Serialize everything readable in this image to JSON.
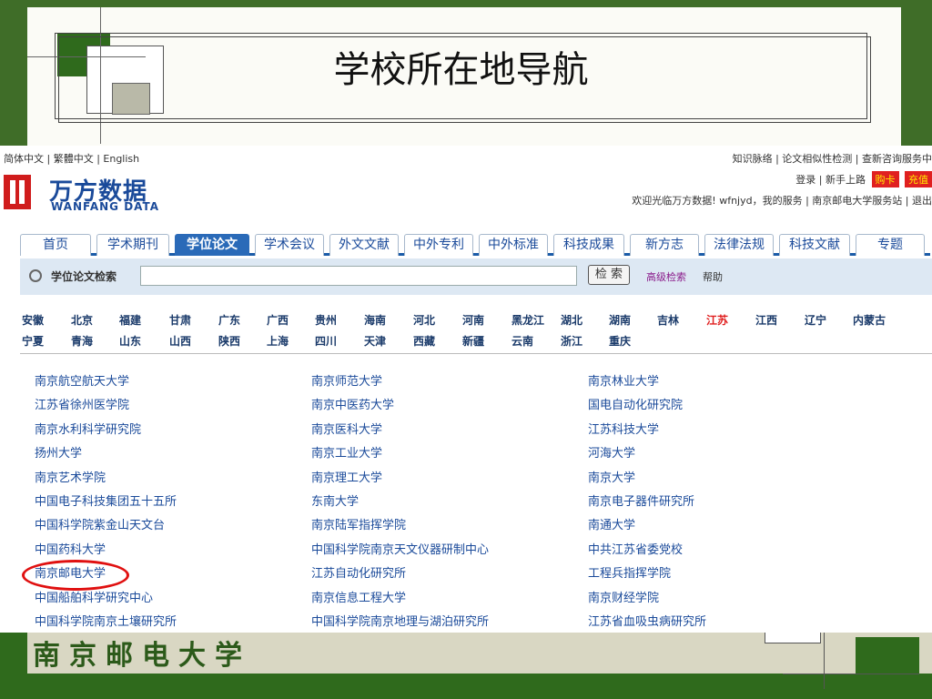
{
  "slide": {
    "title": "学校所在地导航",
    "footer_logo_text": "南京邮电大学"
  },
  "header": {
    "lang": [
      "简体中文",
      "繁體中文",
      "English"
    ],
    "toplinks": [
      "知识脉络",
      "论文相似性检测",
      "查新咨询服务中"
    ],
    "login": {
      "login": "登录",
      "newbie": "新手上路",
      "buy": "购卡",
      "charge": "充值"
    },
    "welcome": "欢迎光临万方数据! wfnjyd，我的服务 | 南京邮电大学服务站 | 退出"
  },
  "brand": {
    "cn": "万方数据",
    "en": "WANFANG DATA"
  },
  "tabs": [
    "首页",
    "学术期刊",
    "学位论文",
    "学术会议",
    "外文文献",
    "中外专利",
    "中外标准",
    "科技成果",
    "新方志",
    "法律法规",
    "科技文献",
    "专题"
  ],
  "search": {
    "label": "学位论文检索",
    "button": "检 索",
    "advanced": "高级检索",
    "help": "帮助"
  },
  "provinces": [
    "安徽",
    "北京",
    "福建",
    "甘肃",
    "广东",
    "广西",
    "贵州",
    "海南",
    "河北",
    "河南",
    "黑龙江",
    "湖北",
    "湖南",
    "吉林",
    "江苏",
    "江西",
    "辽宁",
    "内蒙古",
    "宁夏",
    "青海",
    "山东",
    "山西",
    "陕西",
    "上海",
    "四川",
    "天津",
    "西藏",
    "新疆",
    "云南",
    "浙江",
    "重庆"
  ],
  "selected_province": "江苏",
  "universities": {
    "col1": [
      "南京航空航天大学",
      "江苏省徐州医学院",
      "南京水利科学研究院",
      "扬州大学",
      "南京艺术学院",
      "中国电子科技集团五十五所",
      "中国科学院紫金山天文台",
      "中国药科大学",
      "南京邮电大学",
      "中国船舶科学研究中心",
      "中国科学院南京土壤研究所"
    ],
    "col2": [
      "南京师范大学",
      "南京中医药大学",
      "南京医科大学",
      "南京工业大学",
      "南京理工大学",
      "东南大学",
      "南京陆军指挥学院",
      "中国科学院南京天文仪器研制中心",
      "江苏自动化研究所",
      "南京信息工程大学",
      "中国科学院南京地理与湖泊研究所"
    ],
    "col3": [
      "南京林业大学",
      "国电自动化研究院",
      "江苏科技大学",
      "河海大学",
      "南京大学",
      "南京电子器件研究所",
      "南通大学",
      "中共江苏省委党校",
      "工程兵指挥学院",
      "南京财经学院",
      "江苏省血吸虫病研究所"
    ]
  }
}
